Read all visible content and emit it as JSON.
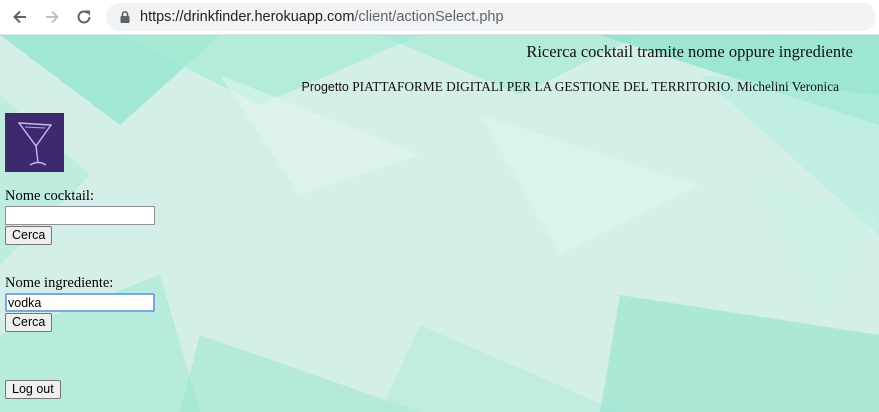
{
  "browser": {
    "url_host": "https://drinkfinder.herokuapp.com",
    "url_path": "/client/actionSelect.php"
  },
  "page": {
    "title": "Ricerca cocktail tramite nome oppure ingrediente",
    "subtitle_prefix": "Progetto ",
    "subtitle_main": "PIATTAFORME DIGITALI PER LA GESTIONE DEL TERRITORIO. Michelini Veronica"
  },
  "cocktail_search": {
    "label": "Nome cocktail:",
    "value": "",
    "button_label": "Cerca"
  },
  "ingredient_search": {
    "label": "Nome ingrediente:",
    "value": "vodka",
    "button_label": "Cerca"
  },
  "logout": {
    "label": "Log out"
  },
  "colors": {
    "background_tint": "#d2efe6",
    "background_accent": "#7fe0c4",
    "logo_bg": "#3d2a6e",
    "focus_border": "#7aa6e6"
  }
}
